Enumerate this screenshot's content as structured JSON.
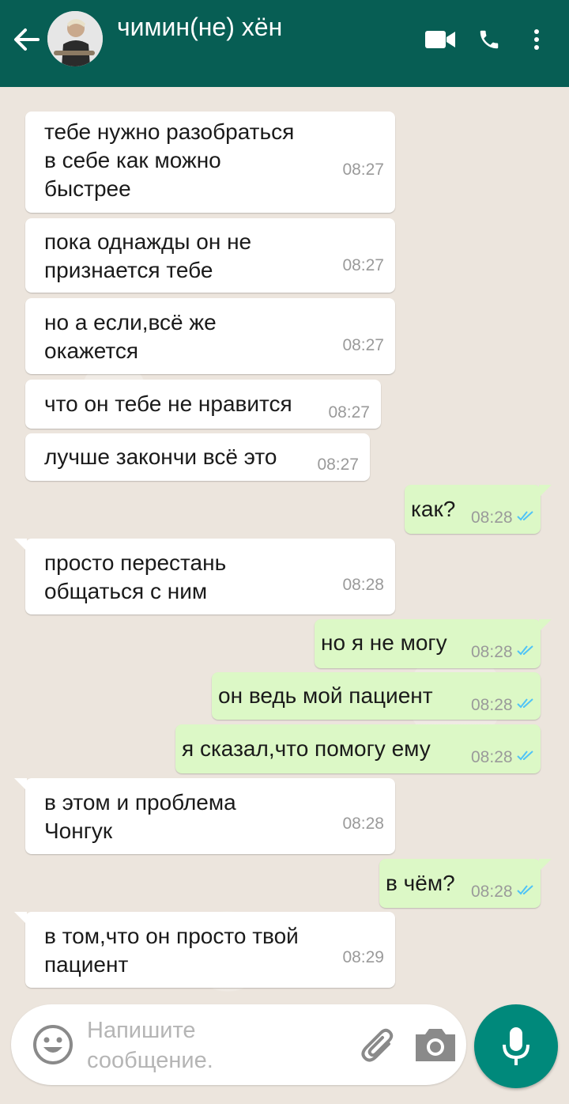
{
  "header": {
    "title": "чимин(не) хён",
    "icons": [
      "back-arrow-icon",
      "avatar",
      "video-call-icon",
      "phone-icon",
      "more-vert-icon"
    ]
  },
  "messages": [
    {
      "dir": "in",
      "text": "тебе нужно разобраться\nв себе как можно\nбыстрее",
      "time": "08:27"
    },
    {
      "dir": "in",
      "text": "пока однажды он не\nпризнается тебе",
      "time": "08:27"
    },
    {
      "dir": "in",
      "text": "но а если,всё же\nокажется",
      "time": "08:27"
    },
    {
      "dir": "in",
      "text": "что он тебе не нравится",
      "time": "08:27"
    },
    {
      "dir": "in",
      "text": "лучше закончи всё это",
      "time": "08:27"
    },
    {
      "dir": "out",
      "text": "как?",
      "time": "08:28",
      "status": "read"
    },
    {
      "dir": "in",
      "text": "просто перестань\nобщаться с ним",
      "time": "08:28"
    },
    {
      "dir": "out",
      "text": "но я не могу",
      "time": "08:28",
      "status": "read"
    },
    {
      "dir": "out",
      "text": "он ведь мой пациент",
      "time": "08:28",
      "status": "read"
    },
    {
      "dir": "out",
      "text": "я сказал,что помогу ему",
      "time": "08:28",
      "status": "read"
    },
    {
      "dir": "in",
      "text": "в этом и проблема\nЧонгук",
      "time": "08:28"
    },
    {
      "dir": "out",
      "text": "в чём?",
      "time": "08:28",
      "status": "read"
    },
    {
      "dir": "in",
      "text": "в том,что он просто твой\nпациент",
      "time": "08:29"
    }
  ],
  "composer": {
    "placeholder": "Напишите\nсообщение.",
    "icons": [
      "emoji-icon",
      "attach-icon",
      "camera-icon",
      "mic-icon"
    ]
  },
  "colors": {
    "header": "#075e54",
    "outgoing_bubble": "#dcf8c6",
    "incoming_bubble": "#ffffff",
    "read_ticks": "#4fc3f7",
    "mic_button": "#00897b"
  }
}
